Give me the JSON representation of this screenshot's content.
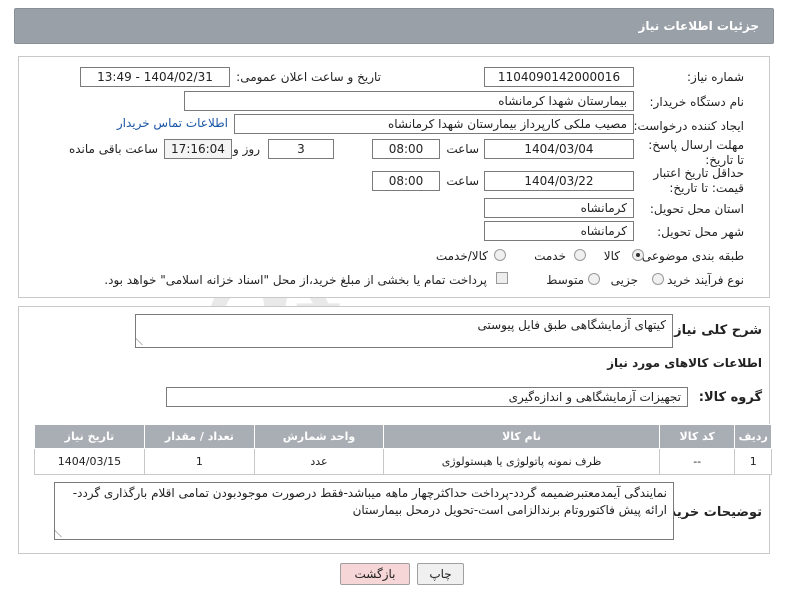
{
  "header": {
    "title": "جزئیات اطلاعات نیاز"
  },
  "form": {
    "need_number_label": "شماره نیاز:",
    "need_number": "1104090142000016",
    "announce_label": "تاریخ و ساعت اعلان عمومی:",
    "announce_value": "1404/02/31 - 13:49",
    "buyer_org_label": "نام دستگاه خریدار:",
    "buyer_org": "بیمارستان شهدا کرمانشاه",
    "creator_label": "ایجاد کننده درخواست:",
    "creator": "مصیب ملکی کارپرداز بیمارستان شهدا کرمانشاه",
    "contact_link": "اطلاعات تماس خریدار",
    "deadline_label": "مهلت ارسال پاسخ: تا تاریخ:",
    "deadline_date": "1404/03/04",
    "time_label": "ساعت",
    "deadline_time": "08:00",
    "days_value": "3",
    "days_label": "روز و",
    "remaining_time": "17:16:04",
    "remaining_label": "ساعت باقی مانده",
    "validity_label": "حداقل تاریخ اعتبار قیمت: تا تاریخ:",
    "validity_date": "1404/03/22",
    "validity_time": "08:00",
    "province_label": "استان محل تحویل:",
    "province": "کرمانشاه",
    "city_label": "شهر محل تحویل:",
    "city": "کرمانشاه",
    "category_label": "طبقه بندی موضوعی:",
    "category_options": [
      "کالا",
      "خدمت",
      "کالا/خدمت"
    ],
    "category_selected": "کالا",
    "process_label": "نوع فرآیند خرید :",
    "process_options": [
      "جزیی",
      "متوسط"
    ],
    "payment_note": "پرداخت تمام یا بخشی از مبلغ خرید،از محل \"اسناد خزانه اسلامی\" خواهد بود."
  },
  "description": {
    "label": "شرح کلی نیاز:",
    "value": "کیتهای آزمایشگاهی طبق فایل پیوستی"
  },
  "goods": {
    "section_title": "اطلاعات کالاهای مورد نیاز",
    "group_label": "گروه کالا:",
    "group_value": "تجهیزات آزمایشگاهی و اندازه‌گیری",
    "table": {
      "headers": [
        "ردیف",
        "کد کالا",
        "نام کالا",
        "واحد شمارش",
        "تعداد / مقدار",
        "تاریخ نیاز"
      ],
      "rows": [
        [
          "1",
          "--",
          "ظرف نمونه پاتولوژی یا هیستولوژی",
          "عدد",
          "1",
          "1404/03/15"
        ]
      ]
    }
  },
  "buyer_notes": {
    "label": "توضیحات خریدار:",
    "value": "نمایندگی آیمدمعتبرضمیمه گردد-پرداخت حداکثرچهار ماهه میباشد-فقط درصورت موجودبودن تمامی اقلام بارگذاری گردد-ارائه پیش فاکتوروتام برندالزامی است-تحویل درمحل بیمارستان"
  },
  "buttons": {
    "print": "چاپ",
    "back": "بازگشت"
  },
  "watermark": {
    "text": "AriaTender.neT"
  }
}
